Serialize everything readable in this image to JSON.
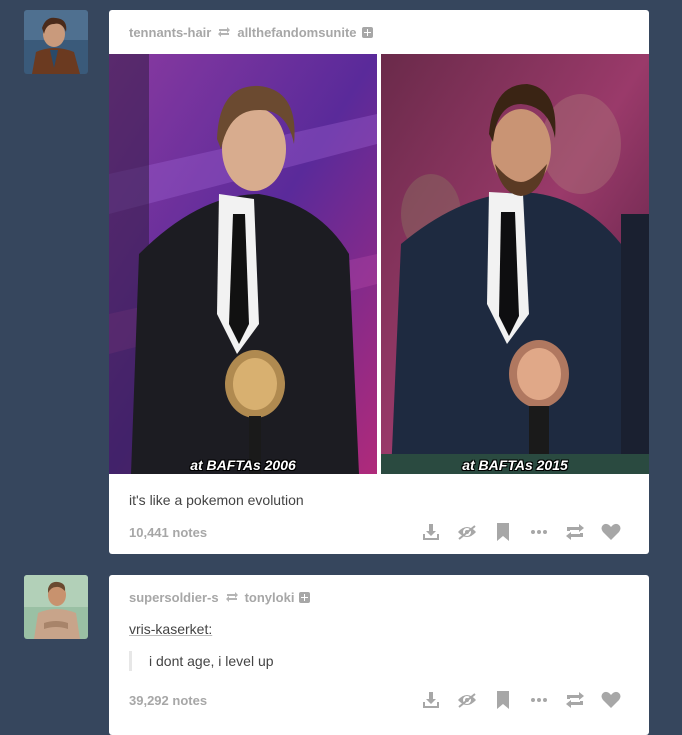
{
  "post1": {
    "author": "tennants-hair",
    "reblogged_from": "allthefandomsunite",
    "image_captions": [
      "at BAFTAs 2006",
      "at BAFTAs 2015"
    ],
    "body_text": "it's like a pokemon evolution",
    "notes": "10,441 notes"
  },
  "post2": {
    "author": "supersoldier-s",
    "reblogged_from": "tonyloki",
    "quoted_user": "vris-kaserket:",
    "quote_text": "i dont age, i level up",
    "notes": "39,292 notes"
  },
  "colors": {
    "background": "#36465d",
    "card": "#ffffff",
    "meta_text": "#a7a7a7",
    "icon": "#a7a7a7"
  },
  "icons": [
    "reblog-icon",
    "plus-icon",
    "download-icon",
    "eye-icon",
    "bookmark-icon",
    "more-icon",
    "reblog-icon",
    "heart-icon"
  ]
}
